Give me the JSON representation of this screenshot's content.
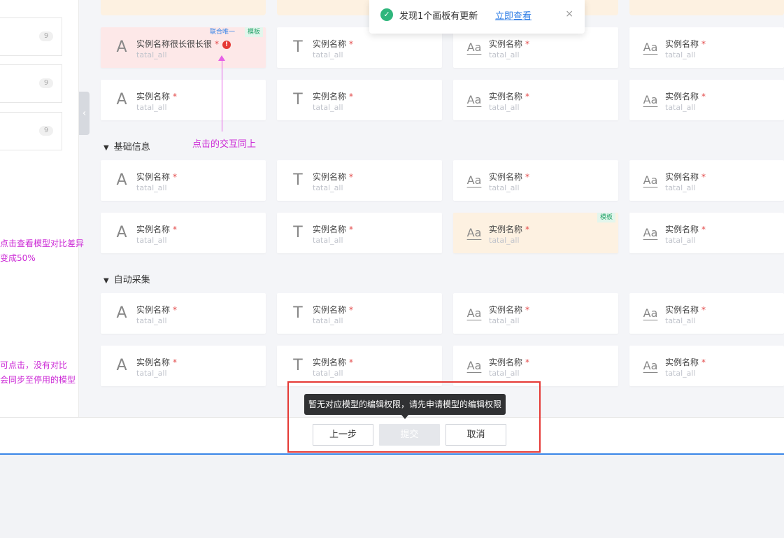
{
  "toast": {
    "message": "发现1个画板有更新",
    "link": "立即查看",
    "close": "×",
    "success_icon": "check-circle-icon",
    "accent": "#2fb67c"
  },
  "left_panel": {
    "items": [
      {
        "count": "9"
      },
      {
        "count": "9"
      },
      {
        "count": "9"
      }
    ],
    "notes": [
      "点击查看模型对比差异",
      "变成50%",
      "可点击，没有对比",
      "会同步至停用的模型"
    ],
    "collapse_icon": "chevron-left-icon"
  },
  "annotation": "点击的交互同上",
  "sections": [
    {
      "title": ""
    },
    {
      "title": "基础信息"
    },
    {
      "title": "自动采集"
    }
  ],
  "cards": {
    "name": "实例名称",
    "long_name": "实例名称很长很长很",
    "required_mark": "*",
    "sub": "tatal_all",
    "glyph_a": "A",
    "glyph_t": "T",
    "glyph_aa": "Aa",
    "tag_union": "联合唯一",
    "tag_template": "模板",
    "error_mark": "!"
  },
  "footer": {
    "tooltip": "暂无对应模型的编辑权限，请先申请模型的编辑权限",
    "prev": "上一步",
    "submit": "提交",
    "cancel": "取消"
  },
  "colors": {
    "error_card": "#fde8e8",
    "template_card": "#fdf1e1",
    "annotation": "#cc2bd6",
    "highlight_box": "#e53935",
    "link": "#2f7ee6"
  }
}
